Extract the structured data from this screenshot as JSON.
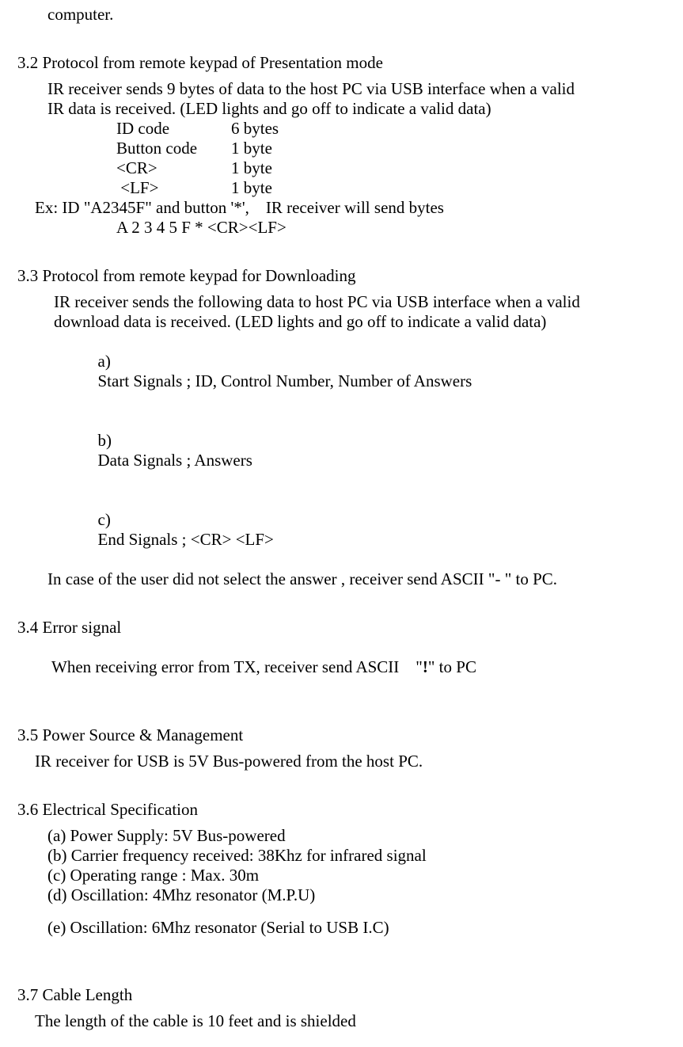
{
  "top_fragment": "computer.",
  "s32": {
    "heading": "3.2 Protocol from remote keypad of Presentation mode",
    "body": [
      "IR receiver sends 9 bytes of data to the host PC via USB interface when a valid",
      "IR data is received. (LED lights and go off to indicate a valid data)"
    ],
    "table": [
      {
        "label": "ID code",
        "value": "6 bytes"
      },
      {
        "label": "Button code",
        "value": "1 byte"
      },
      {
        "label": "<CR>",
        "value": "1 byte"
      },
      {
        "label": " <LF>",
        "value": "1 byte"
      }
    ],
    "ex_line": "Ex: ID \"A2345F\" and button '*',    IR receiver will send bytes",
    "ex_value": "A 2 3 4 5 F * <CR><LF>"
  },
  "s33": {
    "heading": "3.3 Protocol from remote keypad for Downloading",
    "body": [
      "IR receiver sends the following data to host PC via USB interface when a valid",
      "download data is received. (LED lights and go off to indicate a valid data)"
    ],
    "list": [
      {
        "mark": "a)",
        "text": "Start Signals ; ID, Control Number, Number of Answers"
      },
      {
        "mark": "b)",
        "text": "Data Signals ; Answers"
      },
      {
        "mark": "c)",
        "text": "End Signals ; <CR> <LF>"
      }
    ],
    "tail": "In case of the user did not select the answer , receiver send ASCII \"- \" to PC."
  },
  "s34": {
    "heading": "3.4 Error signal",
    "body_pre": "When receiving error from TX, receiver send ASCII    \"",
    "body_bold": "!",
    "body_post": "\" to PC"
  },
  "s35": {
    "heading": "3.5 Power Source & Management",
    "body": "IR receiver for USB is 5V Bus-powered from the host PC."
  },
  "s36": {
    "heading": "3.6 Electrical Specification",
    "items": [
      "(a) Power Supply: 5V Bus-powered",
      "(b) Carrier frequency received: 38Khz for infrared signal",
      "(c) Operating range : Max. 30m",
      "(d) Oscillation: 4Mhz resonator (M.P.U)"
    ],
    "item_e": "(e) Oscillation: 6Mhz resonator (Serial to USB I.C)"
  },
  "s37": {
    "heading": "3.7 Cable Length",
    "body": "The length of the cable is 10 feet and is shielded"
  }
}
